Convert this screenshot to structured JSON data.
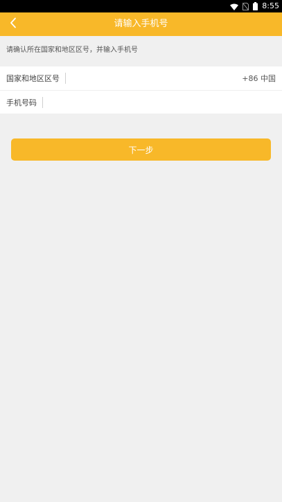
{
  "status_bar": {
    "time": "8:55",
    "icons": [
      "wifi-icon",
      "no-sim-icon",
      "battery-icon"
    ]
  },
  "header": {
    "title": "请输入手机号",
    "back_icon": "chevron-left-icon"
  },
  "hint": "请确认所在国家和地区区号，并输入手机号",
  "form": {
    "region_label": "国家和地区区号",
    "region_value": "+86 中国",
    "phone_label": "手机号码",
    "phone_value": "",
    "phone_placeholder": ""
  },
  "actions": {
    "next_label": "下一步"
  },
  "colors": {
    "accent": "#f8b829",
    "background": "#f0f0f0",
    "surface": "#ffffff",
    "status_bar": "#000000"
  }
}
